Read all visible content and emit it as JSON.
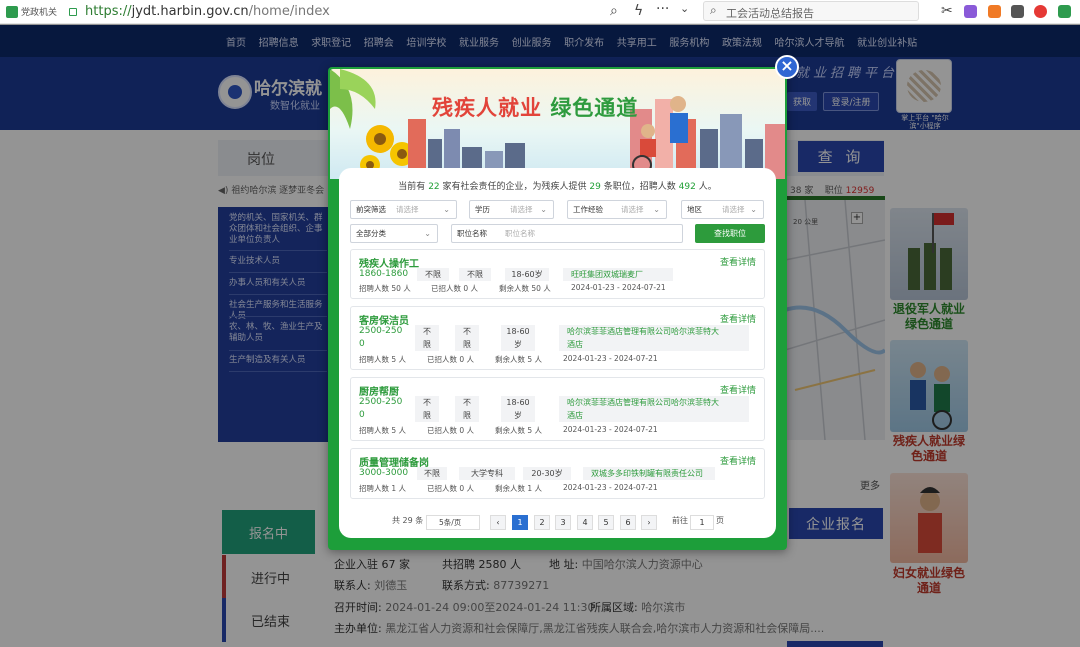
{
  "browser": {
    "badge": "党政机关",
    "url_scheme": "https://",
    "url_host": "jydt.harbin.gov.cn",
    "url_path": "/home/index",
    "search_text": "工会活动总结报告"
  },
  "site_nav": [
    "首页",
    "招聘信息",
    "求职登记",
    "招聘会",
    "培训学校",
    "就业服务",
    "创业服务",
    "职介发布",
    "共享用工",
    "服务机构",
    "政策法规",
    "哈尔滨人才导航",
    "就业创业补贴"
  ],
  "header": {
    "logo_title": "哈尔滨就",
    "logo_sub": "数智化就业",
    "right_text": "就业招聘平台",
    "btn_get": "获取",
    "btn_login": "登录/注册",
    "qr_caption": "掌上平台 \"哈尔滨\"小程序"
  },
  "search": {
    "label": "岗位",
    "query_btn": "查 询",
    "marquee": "祖约哈尔滨 逐梦亚冬会",
    "stat_prefix": "职位",
    "stat_value": "12959",
    "stat_left": "38 家"
  },
  "categories": [
    "党的机关、国家机关、群众团体和社会组织、企事业单位负责人",
    "专业技术人员",
    "办事人员和有关人员",
    "社会生产服务和生活服务人员",
    "农、林、牧、渔业生产及辅助人员",
    "生产制造及有关人员"
  ],
  "map": {
    "scale": "20 公里"
  },
  "promos": {
    "veteran": "退役军人就业绿色通道",
    "disabled": "残疾人就业绿色通道",
    "women": "妇女就业绿色通道",
    "more": "更多"
  },
  "job_fair": {
    "tabs": [
      "报名中",
      "进行中",
      "已结束"
    ],
    "enterprise_btn": "企业报名",
    "companies_label": "企业入驻",
    "companies_value": "67 家",
    "hires_label": "共招聘",
    "hires_value": "2580 人",
    "address_label": "地 址:",
    "address_value": "中国哈尔滨人力资源中心",
    "contact_label": "联系人:",
    "contact_value": "刘德玉",
    "phone_label": "联系方式:",
    "phone_value": "87739271",
    "time_label": "召开时间:",
    "time_value": "2024-01-24 09:00至2024-01-24 11:30",
    "region_label": "所属区域:",
    "region_value": "哈尔滨市",
    "host_label": "主办单位:",
    "host_value": "黑龙江省人力资源和社会保障厅,黑龙江省残疾人联合会,哈尔滨市人力资源和社会保障局...."
  },
  "modal": {
    "hero_title_a": "残疾人就业",
    "hero_title_b": "绿色通道",
    "summary": {
      "p1": "当前有",
      "companies": "22",
      "p2": "家有社会责任的企业，为残疾人提供",
      "positions": "29",
      "p3": "条职位，招聘人数",
      "people": "492",
      "p4": "人。"
    },
    "filters": {
      "shortcut": "前突筛选",
      "education": "学历",
      "experience": "工作经验",
      "region": "地区",
      "placeholder": "请选择",
      "category": "全部分类",
      "job_name": "职位名称",
      "job_name_ph": "职位名称",
      "find_btn": "查找职位"
    },
    "detail_link": "查看详情",
    "jobs": [
      {
        "title": "残疾人操作工",
        "salary": "1860-1860",
        "tag1": "不限",
        "tag2": "不限",
        "age": "18-60岁",
        "company": "旺旺集团双城瑞麦厂",
        "hire": "招聘人数 50 人",
        "hired": "已招人数 0 人",
        "remain": "剩余人数 50 人",
        "dates": "2024-01-23 - 2024-07-21"
      },
      {
        "title": "客房保洁员",
        "salary": "2500-250\n0",
        "tag1": "不\n限",
        "tag2": "不\n限",
        "age": "18-60\n岁",
        "company": "哈尔滨菲菲酒店管理有限公司哈尔滨菲特大\n酒店",
        "hire": "招聘人数 5 人",
        "hired": "已招人数 0 人",
        "remain": "剩余人数 5 人",
        "dates": "2024-01-23 - 2024-07-21"
      },
      {
        "title": "厨房帮厨",
        "salary": "2500-250\n0",
        "tag1": "不\n限",
        "tag2": "不\n限",
        "age": "18-60\n岁",
        "company": "哈尔滨菲菲酒店管理有限公司哈尔滨菲特大\n酒店",
        "hire": "招聘人数 5 人",
        "hired": "已招人数 0 人",
        "remain": "剩余人数 5 人",
        "dates": "2024-01-23 - 2024-07-21"
      },
      {
        "title": "质量管理储备岗",
        "salary": "3000-3000",
        "tag1": "不限",
        "tag2": "大学专科",
        "age": "20-30岁",
        "company": "双城多多印铁制罐有限责任公司",
        "hire": "招聘人数 1 人",
        "hired": "已招人数 0 人",
        "remain": "剩余人数 1 人",
        "dates": "2024-01-23 - 2024-07-21"
      }
    ],
    "pager": {
      "total": "共 29 条",
      "size": "5条/页",
      "pages": [
        "1",
        "2",
        "3",
        "4",
        "5",
        "6"
      ],
      "goto_label": "前往",
      "goto_value": "1",
      "goto_suffix": "页"
    }
  }
}
